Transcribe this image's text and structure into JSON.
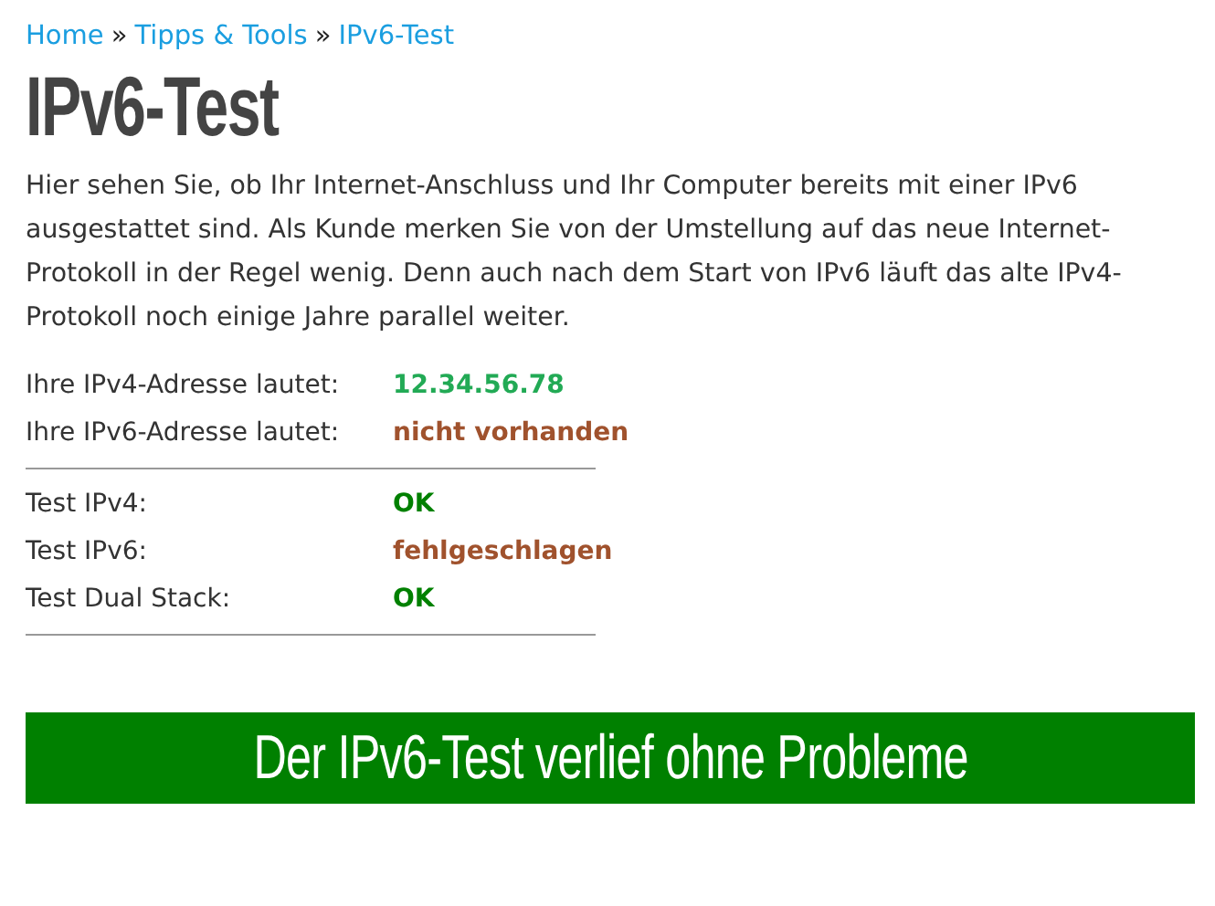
{
  "breadcrumb": [
    {
      "kind": "link",
      "text": "Home"
    },
    {
      "kind": "separator",
      "text": "»"
    },
    {
      "kind": "link",
      "text": "Tipps & Tools"
    },
    {
      "kind": "separator",
      "text": "»"
    },
    {
      "kind": "link",
      "text": "IPv6-Test"
    }
  ],
  "title": "IPv6-Test",
  "intro": "Hier sehen Sie, ob Ihr Internet-Anschluss und Ihr Computer bereits mit einer IPv6 ausgestattet sind. Als Kunde merken Sie von der Umstellung auf das neue Internet-Protokoll in der Regel wenig. Denn auch nach dem Start von IPv6 läuft das alte IPv4-Protokoll noch einige Jahre parallel weiter.",
  "addresses": [
    {
      "label": "Ihre IPv4-Adresse lautet:",
      "value": "12.34.56.78",
      "color": "#22aa55"
    },
    {
      "label": "Ihre IPv6-Adresse lautet:",
      "value": "nicht vorhanden",
      "color": "#a0522d"
    }
  ],
  "tests": [
    {
      "label": "Test IPv4:",
      "value": "OK",
      "color": "#008000"
    },
    {
      "label": "Test IPv6:",
      "value": "fehlgeschlagen",
      "color": "#a0522d"
    },
    {
      "label": "Test Dual Stack:",
      "value": "OK",
      "color": "#008000"
    }
  ],
  "result_banner": "Der IPv6-Test verlief ohne Probleme"
}
